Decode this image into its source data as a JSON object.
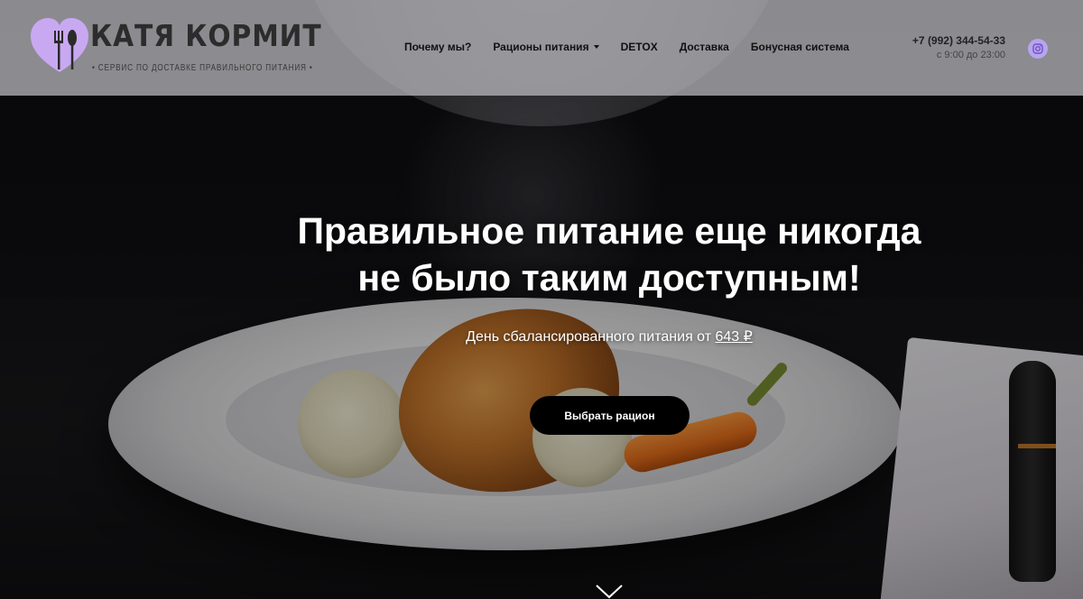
{
  "header": {
    "logo": {
      "title": "КАТЯ КОРМИТ",
      "subtitle": "• СЕРВИС ПО ДОСТАВКЕ ПРАВИЛЬНОГО ПИТАНИЯ •"
    },
    "nav": [
      {
        "label": "Почему мы?",
        "has_dropdown": false
      },
      {
        "label": "Рационы питания",
        "has_dropdown": true
      },
      {
        "label": "DETOX",
        "has_dropdown": false
      },
      {
        "label": "Доставка",
        "has_dropdown": false
      },
      {
        "label": "Бонусная система",
        "has_dropdown": false
      }
    ],
    "contact": {
      "phone": "+7 (992) 344-54-33",
      "hours": "с 9:00 до 23:00"
    },
    "social_icon": "instagram-icon"
  },
  "hero": {
    "title_line1": "Правильное питание еще никогда",
    "title_line2": "не было таким доступным!",
    "subtitle_prefix": "День сбалансированного питания от ",
    "price": "643 ₽",
    "cta_label": "Выбрать рацион",
    "scroll_icon": "chevron-down-icon"
  },
  "colors": {
    "accent": "#b9a4ee",
    "logo_heart": "#c9a8f2",
    "header_bg": "#bebec3",
    "cta_bg": "#000000"
  }
}
